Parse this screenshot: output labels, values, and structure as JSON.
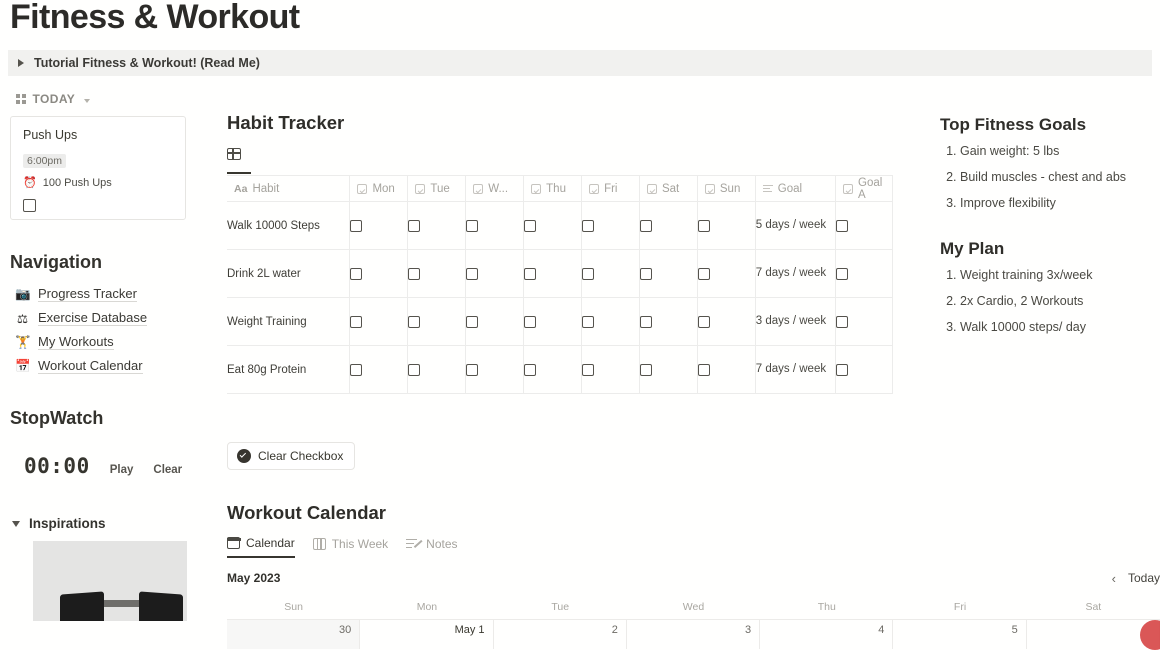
{
  "page": {
    "title": "Fitness & Workout",
    "toggle_banner": {
      "label": "Tutorial Fitness & Workout! (Read Me)",
      "icon": "triangle-right-icon"
    }
  },
  "sidebar": {
    "today": {
      "label": "TODAY",
      "icon": "grid-icon",
      "chevron": "chevron-down-icon"
    },
    "today_card": {
      "title": "Push Ups",
      "time": "6:00pm",
      "detail": "100 Push Ups",
      "detail_icon": "alarm-icon",
      "checkbox_checked": false
    },
    "navigation": {
      "heading": "Navigation",
      "items": [
        {
          "label": "Progress Tracker",
          "icon": "camera-icon"
        },
        {
          "label": "Exercise Database",
          "icon": "weight-person-icon"
        },
        {
          "label": "My Workouts",
          "icon": "dumbbell-icon"
        },
        {
          "label": "Workout Calendar",
          "icon": "calendar-icon"
        }
      ]
    },
    "stopwatch": {
      "heading": "StopWatch",
      "time": "00:00",
      "play_label": "Play",
      "clear_label": "Clear"
    },
    "inspirations": {
      "label": "Inspirations",
      "icon": "triangle-down-icon"
    }
  },
  "habit_tracker": {
    "title": "Habit Tracker",
    "view_icon": "table-view-icon",
    "columns": [
      {
        "label": "Habit",
        "icon": "text-aa-icon"
      },
      {
        "label": "Mon",
        "icon": "checkbox-icon"
      },
      {
        "label": "Tue",
        "icon": "checkbox-icon"
      },
      {
        "label": "W...",
        "icon": "checkbox-icon"
      },
      {
        "label": "Thu",
        "icon": "checkbox-icon"
      },
      {
        "label": "Fri",
        "icon": "checkbox-icon"
      },
      {
        "label": "Sat",
        "icon": "checkbox-icon"
      },
      {
        "label": "Sun",
        "icon": "checkbox-icon"
      },
      {
        "label": "Goal",
        "icon": "text-lines-icon"
      },
      {
        "label": "Goal A",
        "icon": "checkbox-icon"
      }
    ],
    "rows": [
      {
        "habit": "Walk 10000 Steps",
        "goal": "5 days / week",
        "days": [
          false,
          false,
          false,
          false,
          false,
          false,
          false
        ],
        "goal_achieved": false
      },
      {
        "habit": "Drink 2L water",
        "goal": "7 days / week",
        "days": [
          false,
          false,
          false,
          false,
          false,
          false,
          false
        ],
        "goal_achieved": false
      },
      {
        "habit": "Weight Training",
        "goal": "3 days / week",
        "days": [
          false,
          false,
          false,
          false,
          false,
          false,
          false
        ],
        "goal_achieved": false
      },
      {
        "habit": "Eat 80g Protein",
        "goal": "7 days / week",
        "days": [
          false,
          false,
          false,
          false,
          false,
          false,
          false
        ],
        "goal_achieved": false
      }
    ],
    "clear_button": {
      "label": "Clear Checkbox",
      "icon": "check-badge-icon"
    }
  },
  "workout_calendar": {
    "title": "Workout Calendar",
    "tabs": [
      {
        "label": "Calendar",
        "icon": "calendar-icon",
        "active": true
      },
      {
        "label": "This Week",
        "icon": "board-icon",
        "active": false
      },
      {
        "label": "Notes",
        "icon": "notes-icon",
        "active": false
      }
    ],
    "month": "May 2023",
    "nav": {
      "prev": "‹",
      "today": "Today"
    },
    "day_headers": [
      "Sun",
      "Mon",
      "Tue",
      "Wed",
      "Thu",
      "Fri",
      "Sat"
    ],
    "cells": [
      {
        "label": "30",
        "other_month": true
      },
      {
        "label": "May 1",
        "other_month": false
      },
      {
        "label": "2",
        "other_month": false
      },
      {
        "label": "3",
        "other_month": false
      },
      {
        "label": "4",
        "other_month": false
      },
      {
        "label": "5",
        "other_month": false
      },
      {
        "label": "",
        "other_month": false
      }
    ]
  },
  "right_column": {
    "goals": {
      "heading": "Top Fitness Goals",
      "items": [
        "Gain weight: 5 lbs",
        "Build muscles - chest and abs",
        "Improve flexibility"
      ]
    },
    "plan": {
      "heading": "My Plan",
      "items": [
        "Weight training 3x/week",
        "2x Cardio, 2 Workouts",
        "Walk 10000 steps/ day"
      ]
    }
  },
  "colors": {
    "banner_bg": "#f1f1ef",
    "text": "#37352f",
    "muted": "#a5a39d",
    "cursor": "#d64545"
  }
}
